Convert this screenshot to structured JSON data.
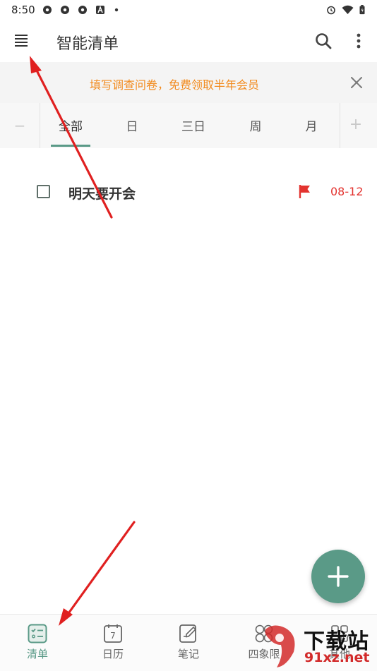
{
  "status_bar": {
    "time": "8:50",
    "icons": [
      "app-icon",
      "app-icon",
      "app-icon",
      "a-icon",
      "dot-icon",
      "alarm-icon",
      "wifi-icon",
      "battery-icon"
    ]
  },
  "toolbar": {
    "title": "智能清单",
    "icons": [
      "menu-icon",
      "search-icon",
      "more-vert-icon"
    ]
  },
  "banner": {
    "text": "填写调查问卷，免费领取半年会员",
    "close_icon": "close-icon"
  },
  "tabs": {
    "minus": "−",
    "plus": "+",
    "items": [
      {
        "label": "全部",
        "active": true
      },
      {
        "label": "日",
        "active": false
      },
      {
        "label": "三日",
        "active": false
      },
      {
        "label": "周",
        "active": false
      },
      {
        "label": "月",
        "active": false
      }
    ]
  },
  "tasks": [
    {
      "title": "明天要开会",
      "date": "08-12",
      "flag_icon": "flag-icon",
      "flag_color": "#e3332f"
    }
  ],
  "fab": {
    "icon": "plus-icon"
  },
  "bottom_nav": [
    {
      "label": "清单",
      "icon": "checklist-icon",
      "active": true
    },
    {
      "label": "日历",
      "icon": "calendar-icon",
      "calendar_day": "7",
      "active": false
    },
    {
      "label": "笔记",
      "icon": "note-edit-icon",
      "active": false
    },
    {
      "label": "四象限",
      "icon": "quadrant-icon",
      "active": false
    },
    {
      "label": "其他",
      "icon": "other-icon",
      "active": false
    }
  ],
  "watermark": {
    "main": "下载站",
    "sub": "91xz.net"
  },
  "colors": {
    "accent": "#5a9a87",
    "banner_text": "#f28a1d",
    "date_text": "#e3332f",
    "arrow": "#e02020"
  }
}
